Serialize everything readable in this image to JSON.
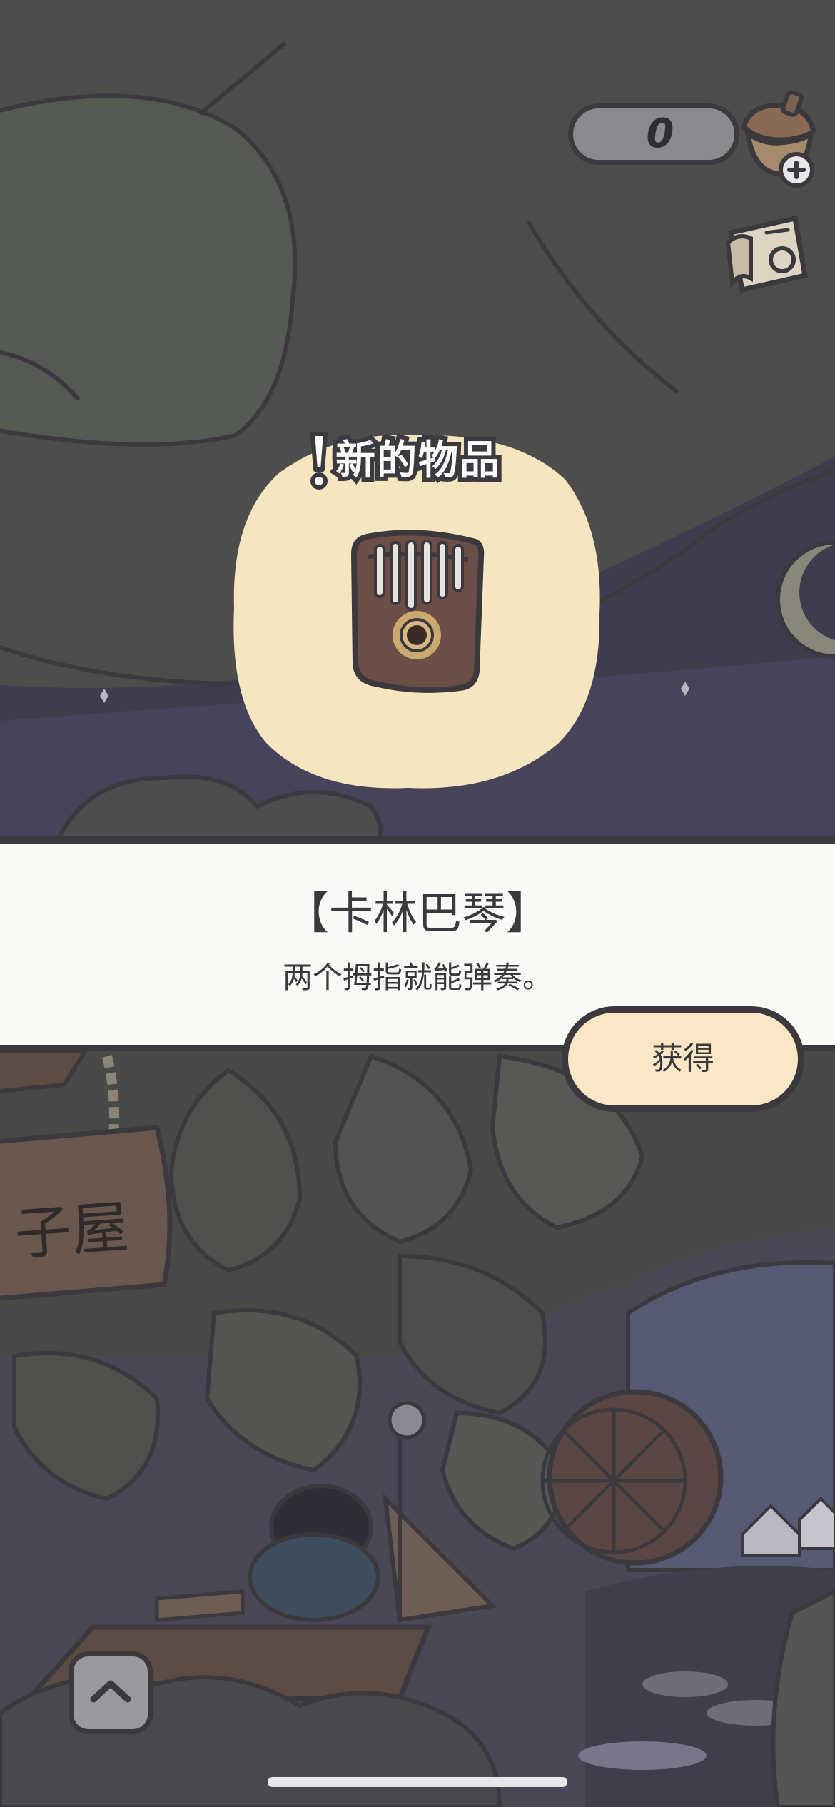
{
  "hud": {
    "acorn_count": "0",
    "acorn_icon": "acorn-plus-icon",
    "notes_icon": "notes-icon"
  },
  "popup": {
    "new_item_label": "新的物品",
    "item_icon": "kalimba-icon"
  },
  "item": {
    "name": "【卡林巴琴】",
    "description": "两个拇指就能弹奏。"
  },
  "actions": {
    "obtain_label": "获得",
    "collapse_icon": "chevron-up-icon"
  },
  "background": {
    "sign_text": "子屋"
  },
  "colors": {
    "outline": "#3b383e",
    "bubble": "#f5e6bf",
    "panel": "#fbfaf7",
    "button": "#fbe7c6"
  }
}
